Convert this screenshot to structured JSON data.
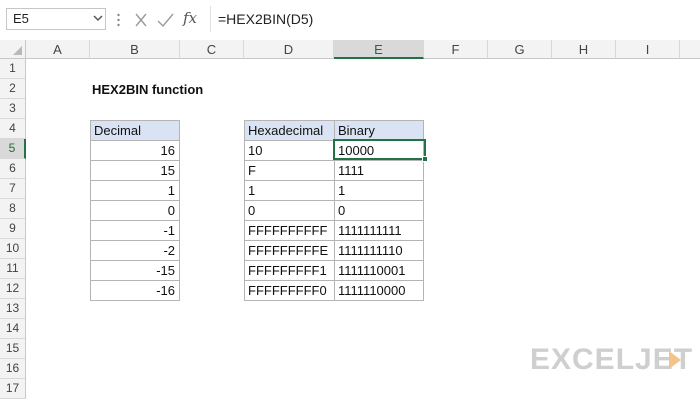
{
  "formula_bar": {
    "name_box": "E5",
    "formula": "=HEX2BIN(D5)",
    "fx_label": "fx"
  },
  "columns": [
    "A",
    "B",
    "C",
    "D",
    "E",
    "F",
    "G",
    "H",
    "I"
  ],
  "selected_column": "E",
  "rows": [
    "1",
    "2",
    "3",
    "4",
    "5",
    "6",
    "7",
    "8",
    "9",
    "10",
    "11",
    "12",
    "13",
    "14",
    "15",
    "16",
    "17"
  ],
  "selected_row": "5",
  "sheet": {
    "title": "HEX2BIN function",
    "decimal_table": {
      "header": "Decimal",
      "values": [
        "16",
        "15",
        "1",
        "0",
        "-1",
        "-2",
        "-15",
        "-16"
      ]
    },
    "hex_table": {
      "headers": [
        "Hexadecimal",
        "Binary"
      ],
      "rows": [
        [
          "10",
          "10000"
        ],
        [
          "F",
          "1111"
        ],
        [
          "1",
          "1"
        ],
        [
          "0",
          "0"
        ],
        [
          "FFFFFFFFFF",
          "1111111111"
        ],
        [
          "FFFFFFFFFE",
          "1111111110"
        ],
        [
          "FFFFFFFFF1",
          "1111110001"
        ],
        [
          "FFFFFFFFF0",
          "1111110000"
        ]
      ]
    }
  },
  "watermark": "EXCELJET",
  "colors": {
    "accent_green": "#217346",
    "table_header_fill": "#dae3f3"
  }
}
